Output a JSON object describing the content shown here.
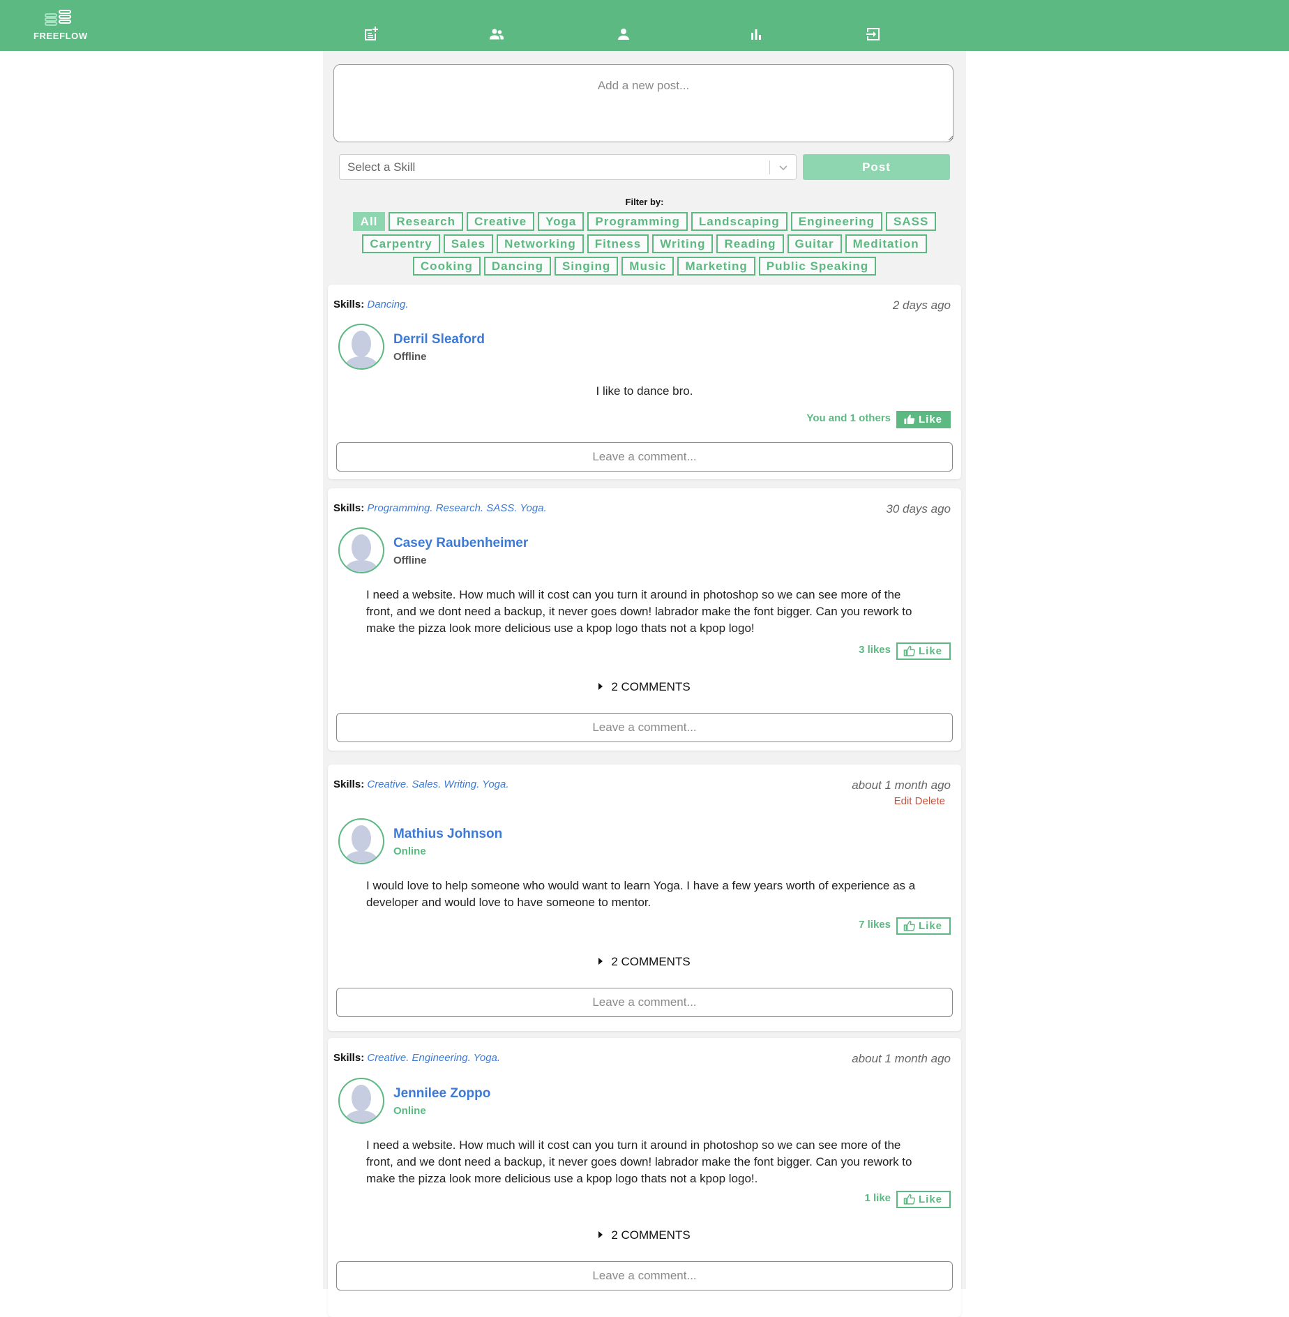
{
  "nav": {
    "brand": "FREEFLOW",
    "icons": [
      "new-post-icon",
      "people-icon",
      "profile-icon",
      "stats-icon",
      "logout-icon"
    ],
    "color": "#5cb981"
  },
  "composer": {
    "placeholder": "Add a new post...",
    "skill_placeholder": "Select a Skill",
    "post_label": "Post"
  },
  "filter": {
    "label": "Filter by:",
    "rows": [
      [
        "All",
        "Research",
        "Creative",
        "Yoga",
        "Programming",
        "Landscaping",
        "Engineering",
        "SASS"
      ],
      [
        "Carpentry",
        "Sales",
        "Networking",
        "Fitness",
        "Writing",
        "Reading",
        "Guitar",
        "Meditation"
      ],
      [
        "Cooking",
        "Dancing",
        "Singing",
        "Music",
        "Marketing",
        "Public Speaking"
      ]
    ],
    "active": "All"
  },
  "posts": [
    {
      "skills_label": "Skills:",
      "skills": "Dancing.",
      "time": "2 days ago",
      "author": "Derril Sleaford",
      "status": "Offline",
      "body": "I like to dance bro.",
      "likes": "You and 1 others",
      "like_label": "Like",
      "liked": true,
      "comment_placeholder": "Leave a comment..."
    },
    {
      "skills_label": "Skills:",
      "skills": "Programming. Research. SASS. Yoga.",
      "time": "30 days ago",
      "author": "Casey Raubenheimer",
      "status": "Offline",
      "body": "I need a website. How much will it cost can you turn it around in photoshop so we can see more of the front, and we dont need a backup, it never goes down! labrador make the font bigger. Can you rework to make the pizza look more delicious use a kpop logo thats not a kpop logo!",
      "likes": "3 likes",
      "like_label": "Like",
      "liked": false,
      "comments": "2 COMMENTS",
      "comment_placeholder": "Leave a comment..."
    },
    {
      "skills_label": "Skills:",
      "skills": "Creative. Sales. Writing. Yoga.",
      "time": "about 1 month ago",
      "edit_label": "Edit",
      "delete_label": "Delete",
      "author": "Mathius Johnson",
      "status": "Online",
      "body": "I would love to help someone who would want to learn Yoga. I have a few years worth of experience as a developer and would love to have someone to mentor.",
      "likes": "7 likes",
      "like_label": "Like",
      "liked": false,
      "comments": "2 COMMENTS",
      "comment_placeholder": "Leave a comment..."
    },
    {
      "skills_label": "Skills:",
      "skills": "Creative. Engineering. Yoga.",
      "time": "about 1 month ago",
      "author": "Jennilee Zoppo",
      "status": "Online",
      "body": "I need a website. How much will it cost can you turn it around in photoshop so we can see more of the front, and we dont need a backup, it never goes down! labrador make the font bigger. Can you rework to make the pizza look more delicious use a kpop logo thats not a kpop logo!.",
      "likes": "1 like",
      "like_label": "Like",
      "liked": false,
      "comments": "2 COMMENTS",
      "comment_placeholder": "Leave a comment..."
    }
  ]
}
